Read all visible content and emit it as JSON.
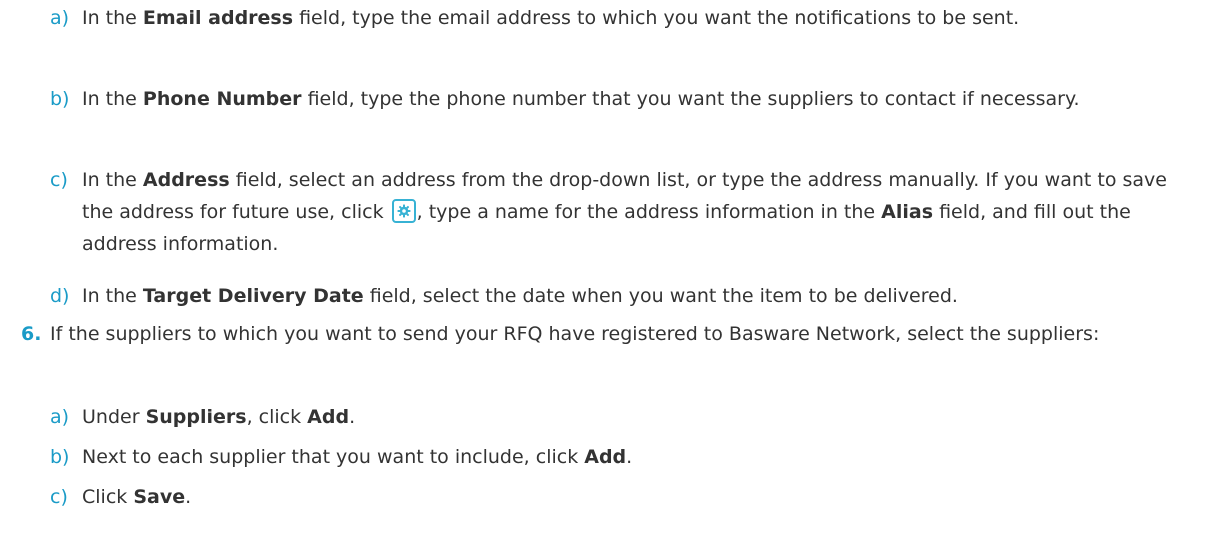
{
  "substeps_a": [
    {
      "marker": "a)",
      "pre": "In the ",
      "bold": "Email address",
      "post": " field, type the email address to which you want the notifications to be sent."
    },
    {
      "marker": "b)",
      "pre": "In the ",
      "bold": "Phone Number",
      "post": " field, type the phone number that you want the suppliers to contact if necessary."
    },
    {
      "marker": "c)",
      "pre": "In the ",
      "bold": "Address",
      "post": " field, select an address from the drop-down list, or type the address manually. If you want to save the address for future use, click ",
      "icon": "gear-icon",
      "post2": ", type a name for the address information in the ",
      "bold2": "Alias",
      "post3": " field, and fill out the address information."
    },
    {
      "marker": "d)",
      "pre": "In the ",
      "bold": "Target Delivery Date",
      "post": " field, select the date when you want the item to be delivered."
    }
  ],
  "step6": {
    "number": "6.",
    "text": "If the suppliers to which you want to send your RFQ have registered to Basware Network, select the suppliers:"
  },
  "substeps_b": [
    {
      "marker": "a)",
      "pre": "Under ",
      "bold": "Suppliers",
      "mid": ", click ",
      "bold2": "Add",
      "post": "."
    },
    {
      "marker": "b)",
      "pre": "Next to each supplier that you want to include, click ",
      "bold": "Add",
      "post": "."
    },
    {
      "marker": "c)",
      "pre": "Click ",
      "bold": "Save",
      "post": "."
    }
  ],
  "colors": {
    "accent": "#1a9bc7",
    "text": "#333333",
    "icon_border": "#37b2d4"
  }
}
